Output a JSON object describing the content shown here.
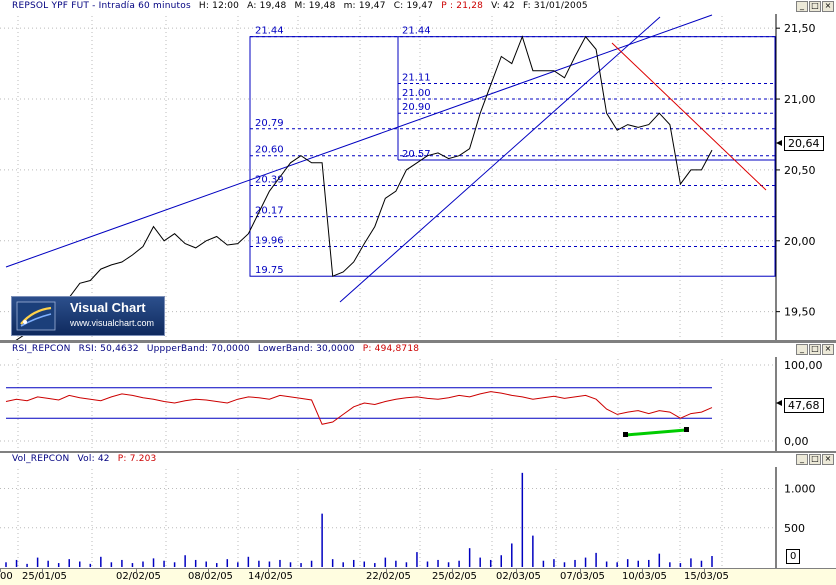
{
  "price_panel": {
    "title": {
      "name": "REPSOL YPF FUT - Intradía 60 minutos",
      "high": "H: 12:00",
      "open": "A: 19,48",
      "max": "M: 19,48",
      "min": "m: 19,47",
      "close": "C: 19,47",
      "p": "P : 21,28",
      "vol": "V: 42",
      "date": "F: 31/01/2005"
    },
    "axis_labels": [
      "21,50",
      "21,00",
      "20,50",
      "20,00",
      "19,50"
    ],
    "current_value": "20,64",
    "fib_labels": [
      "21.44",
      "21.44",
      "21.11",
      "21.00",
      "20.90",
      "20.79",
      "20.60",
      "20.57",
      "20.39",
      "20.17",
      "19.96",
      "19.75"
    ]
  },
  "logo": {
    "title": "Visual Chart",
    "url": "www.visualchart.com"
  },
  "rsi_panel": {
    "title": {
      "name": "RSI_REPCON",
      "rsi": "RSI: 50,4632",
      "upper": "UppperBand: 70,0000",
      "lower": "LowerBand: 30,0000",
      "p": "P: 494,8718"
    },
    "axis_labels": [
      "100,00",
      "0,00"
    ],
    "current_value": "47,68"
  },
  "vol_panel": {
    "title": {
      "name": "Vol_REPCON",
      "vol": "Vol: 42",
      "p": "P: 7.203"
    },
    "axis_labels": [
      "1.000",
      "500"
    ],
    "current_value": "0"
  },
  "date_axis": [
    "00",
    "25/01/05",
    "02/02/05",
    "08/02/05",
    "14/02/05",
    "22/02/05",
    "25/02/05",
    "02/03/05",
    "07/03/05",
    "10/03/05",
    "15/03/05"
  ],
  "window_buttons": {
    "min": "_",
    "restore": "□",
    "close": "×"
  },
  "colors": {
    "line_blue": "#0000c0",
    "rsi_red": "#cc0000",
    "volume_blue": "#0000c0",
    "trend_red": "#dd0000",
    "trend_green": "#00cc00"
  },
  "chart_data": [
    {
      "type": "line",
      "title": "REPSOL YPF FUT - Intradía 60 minutos",
      "ylim": [
        19.3,
        21.6
      ],
      "series": [
        {
          "name": "REPSOL YPF FUT",
          "values": [
            19.25,
            19.3,
            19.35,
            19.38,
            19.45,
            19.52,
            19.6,
            19.7,
            19.72,
            19.8,
            19.83,
            19.85,
            19.9,
            19.96,
            20.1,
            20.0,
            20.05,
            19.98,
            19.95,
            20.0,
            20.03,
            19.97,
            19.98,
            20.05,
            20.2,
            20.35,
            20.45,
            20.55,
            20.6,
            20.55,
            20.55,
            19.75,
            19.78,
            19.85,
            19.98,
            20.1,
            20.3,
            20.35,
            20.5,
            20.55,
            20.6,
            20.62,
            20.58,
            20.6,
            20.65,
            20.9,
            21.1,
            21.3,
            21.25,
            21.44,
            21.2,
            21.2,
            21.2,
            21.15,
            21.3,
            21.44,
            21.35,
            20.9,
            20.78,
            20.82,
            20.8,
            20.82,
            20.9,
            20.82,
            20.4,
            20.5,
            20.5,
            20.64
          ]
        }
      ]
    },
    {
      "type": "line",
      "title": "RSI_REPCON",
      "ylim": [
        0,
        100
      ],
      "series": [
        {
          "name": "RSI",
          "values": [
            52,
            55,
            53,
            58,
            56,
            54,
            60,
            57,
            55,
            53,
            58,
            62,
            60,
            57,
            55,
            52,
            50,
            53,
            55,
            54,
            52,
            50,
            55,
            58,
            57,
            55,
            60,
            58,
            56,
            54,
            22,
            25,
            35,
            45,
            50,
            48,
            52,
            55,
            57,
            58,
            56,
            55,
            57,
            60,
            58,
            62,
            65,
            63,
            60,
            58,
            55,
            57,
            59,
            56,
            58,
            60,
            55,
            42,
            35,
            38,
            40,
            36,
            40,
            38,
            30,
            36,
            38,
            44
          ]
        },
        {
          "name": "UppperBand",
          "values": [
            70
          ]
        },
        {
          "name": "LowerBand",
          "values": [
            30
          ]
        }
      ]
    },
    {
      "type": "bar",
      "title": "Vol_REPCON",
      "ylim": [
        0,
        1300
      ],
      "series": [
        {
          "name": "Vol",
          "values": [
            60,
            90,
            40,
            120,
            80,
            50,
            100,
            70,
            40,
            130,
            60,
            90,
            50,
            70,
            110,
            80,
            60,
            150,
            90,
            70,
            50,
            100,
            60,
            130,
            80,
            70,
            90,
            60,
            50,
            80,
            680,
            100,
            60,
            90,
            70,
            50,
            120,
            80,
            60,
            190,
            70,
            90,
            60,
            80,
            240,
            120,
            90,
            150,
            300,
            1200,
            400,
            80,
            100,
            60,
            90,
            120,
            180,
            70,
            60,
            100,
            80,
            90,
            170,
            60,
            50,
            110,
            80,
            140
          ]
        }
      ]
    }
  ]
}
